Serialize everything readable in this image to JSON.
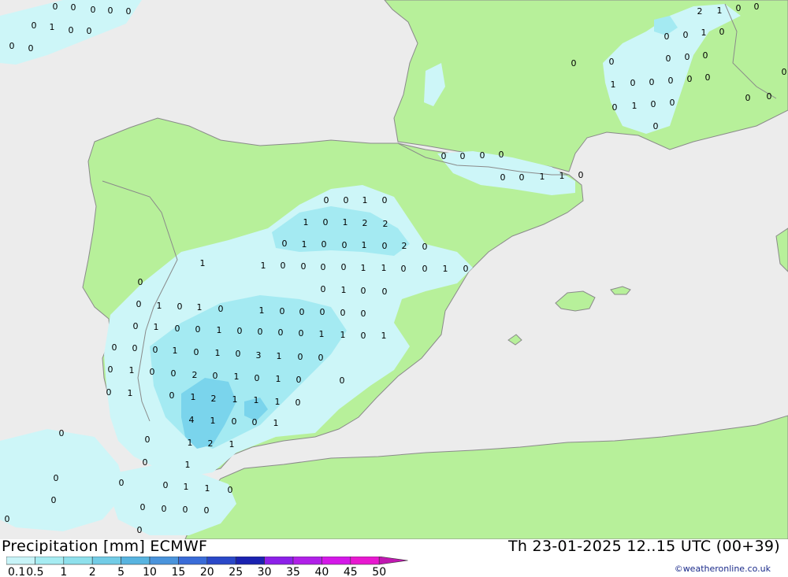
{
  "title": "Precipitation [mm] ECMWF",
  "datetime": "Th 23-01-2025 12..15 UTC (00+39)",
  "credit": "©weatheronline.co.uk",
  "legend": {
    "labels": [
      "0.1",
      "0.5",
      "1",
      "2",
      "5",
      "10",
      "15",
      "20",
      "25",
      "30",
      "35",
      "40",
      "45",
      "50"
    ],
    "colors": [
      "#c8f4f8",
      "#a6ecf2",
      "#8ee0ec",
      "#72cce6",
      "#58b4e0",
      "#4a94dc",
      "#3a6cd8",
      "#2a48c8",
      "#1a22b0",
      "#8c20e8",
      "#b020e8",
      "#d418e8",
      "#e818d0",
      "#c018b0"
    ]
  },
  "colors": {
    "sea": "#ececec",
    "land": "#b7f09a",
    "precip_light": "#cdf6f8",
    "precip_mid": "#a4eaf2",
    "precip_strong": "#7ad4ec",
    "border": "#8a8a8a"
  },
  "map_values": [
    {
      "v": "0",
      "c": "sea"
    },
    {
      "v": "0",
      "c": "sea"
    },
    {
      "v": "0",
      "c": "sea"
    },
    {
      "v": "0",
      "c": "sea"
    },
    {
      "v": "0",
      "c": "sea"
    },
    {
      "v": "0"
    },
    {
      "v": "1"
    },
    {
      "v": "0"
    },
    {
      "v": "0"
    },
    {
      "v": "0"
    },
    {
      "v": "0"
    },
    {
      "v": "0"
    },
    {
      "v": "2"
    },
    {
      "v": "1"
    },
    {
      "v": "0"
    },
    {
      "v": "0"
    },
    {
      "v": "0"
    },
    {
      "v": "0"
    },
    {
      "v": "1"
    },
    {
      "v": "0"
    },
    {
      "v": "0"
    },
    {
      "v": "0"
    },
    {
      "v": "0"
    },
    {
      "v": "0"
    },
    {
      "v": "0"
    },
    {
      "v": "1"
    },
    {
      "v": "0"
    },
    {
      "v": "0"
    },
    {
      "v": "0"
    },
    {
      "v": "0"
    },
    {
      "v": "0"
    },
    {
      "v": "0"
    },
    {
      "v": "1"
    },
    {
      "v": "0"
    },
    {
      "v": "0"
    },
    {
      "v": "0"
    },
    {
      "v": "0"
    },
    {
      "v": "0"
    },
    {
      "v": "0"
    },
    {
      "v": "0"
    },
    {
      "v": "0"
    },
    {
      "v": "0"
    },
    {
      "v": "0"
    },
    {
      "v": "0"
    },
    {
      "v": "1"
    },
    {
      "v": "1"
    },
    {
      "v": "0"
    },
    {
      "v": "0"
    },
    {
      "v": "0"
    },
    {
      "v": "1"
    },
    {
      "v": "0"
    },
    {
      "v": "1"
    },
    {
      "v": "0"
    },
    {
      "v": "1"
    },
    {
      "v": "2"
    },
    {
      "v": "2"
    },
    {
      "v": "0"
    },
    {
      "v": "1"
    },
    {
      "v": "0"
    },
    {
      "v": "0"
    },
    {
      "v": "1"
    },
    {
      "v": "0"
    },
    {
      "v": "2"
    },
    {
      "v": "0"
    },
    {
      "v": "1"
    },
    {
      "v": "1"
    },
    {
      "v": "0"
    },
    {
      "v": "0"
    },
    {
      "v": "0"
    },
    {
      "v": "0"
    },
    {
      "v": "1"
    },
    {
      "v": "1"
    },
    {
      "v": "0"
    },
    {
      "v": "0"
    },
    {
      "v": "1"
    },
    {
      "v": "0"
    },
    {
      "v": "0"
    },
    {
      "v": "0"
    },
    {
      "v": "1"
    },
    {
      "v": "0"
    },
    {
      "v": "0"
    },
    {
      "v": "0"
    },
    {
      "v": "1"
    },
    {
      "v": "0"
    },
    {
      "v": "1"
    },
    {
      "v": "0"
    },
    {
      "v": "1"
    },
    {
      "v": "0"
    },
    {
      "v": "0"
    },
    {
      "v": "0"
    },
    {
      "v": "0"
    },
    {
      "v": "0"
    },
    {
      "v": "0"
    },
    {
      "v": "1"
    },
    {
      "v": "0"
    },
    {
      "v": "0"
    },
    {
      "v": "1"
    },
    {
      "v": "0"
    },
    {
      "v": "0"
    },
    {
      "v": "0"
    },
    {
      "v": "0"
    },
    {
      "v": "1"
    },
    {
      "v": "1"
    },
    {
      "v": "0"
    },
    {
      "v": "1"
    },
    {
      "v": "0"
    },
    {
      "v": "0"
    },
    {
      "v": "0"
    },
    {
      "v": "1"
    },
    {
      "v": "0"
    },
    {
      "v": "1"
    },
    {
      "v": "0"
    },
    {
      "v": "3"
    },
    {
      "v": "1"
    },
    {
      "v": "0"
    },
    {
      "v": "0"
    },
    {
      "v": "0"
    },
    {
      "v": "1"
    },
    {
      "v": "0"
    },
    {
      "v": "0"
    },
    {
      "v": "2"
    },
    {
      "v": "0"
    },
    {
      "v": "1"
    },
    {
      "v": "0"
    },
    {
      "v": "1"
    },
    {
      "v": "0"
    },
    {
      "v": "0"
    },
    {
      "v": "0"
    },
    {
      "v": "1"
    },
    {
      "v": "0"
    },
    {
      "v": "1"
    },
    {
      "v": "2"
    },
    {
      "v": "1"
    },
    {
      "v": "1"
    },
    {
      "v": "1"
    },
    {
      "v": "0"
    },
    {
      "v": "4"
    },
    {
      "v": "1"
    },
    {
      "v": "0"
    },
    {
      "v": "0"
    },
    {
      "v": "1"
    },
    {
      "v": "0",
      "c": "sea"
    },
    {
      "v": "0"
    },
    {
      "v": "1"
    },
    {
      "v": "2"
    },
    {
      "v": "1"
    },
    {
      "v": "0"
    },
    {
      "v": "1"
    },
    {
      "v": "0"
    },
    {
      "v": "0"
    },
    {
      "v": "0"
    },
    {
      "v": "1"
    },
    {
      "v": "1"
    },
    {
      "v": "0"
    },
    {
      "v": "0"
    },
    {
      "v": "0"
    },
    {
      "v": "0"
    },
    {
      "v": "0"
    },
    {
      "v": "0"
    },
    {
      "v": "0"
    },
    {
      "v": "0"
    }
  ]
}
